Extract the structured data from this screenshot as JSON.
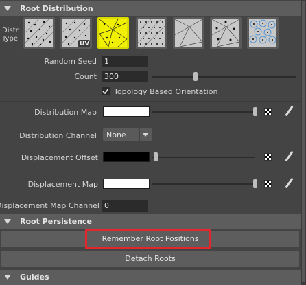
{
  "sections": {
    "root_distribution": {
      "title": "Root Distribution"
    },
    "root_persistence": {
      "title": "Root Persistence"
    },
    "guides": {
      "title": "Guides"
    }
  },
  "distribution": {
    "label_line1": "Distr.",
    "label_line2": "Type",
    "uv_badge": "UV",
    "selected_index": 2,
    "accent_color": "#d9d900"
  },
  "fields": {
    "random_seed": {
      "label": "Random Seed",
      "value": "1"
    },
    "count": {
      "label": "Count",
      "value": "300"
    },
    "topology": {
      "label": "Topology Based Orientation",
      "checked": true
    },
    "distribution_map": {
      "label": "Distribution Map"
    },
    "distribution_channel": {
      "label": "Distribution Channel",
      "value": "None"
    },
    "displacement_offset": {
      "label": "Displacement Offset"
    },
    "displacement_map": {
      "label": "Displacement Map"
    },
    "displacement_map_channel": {
      "label": "Displacement Map Channel",
      "value": "0"
    }
  },
  "buttons": {
    "remember_root_positions": "Remember Root Positions",
    "detach_roots": "Detach Roots",
    "highlight_color": "#e5252c"
  }
}
